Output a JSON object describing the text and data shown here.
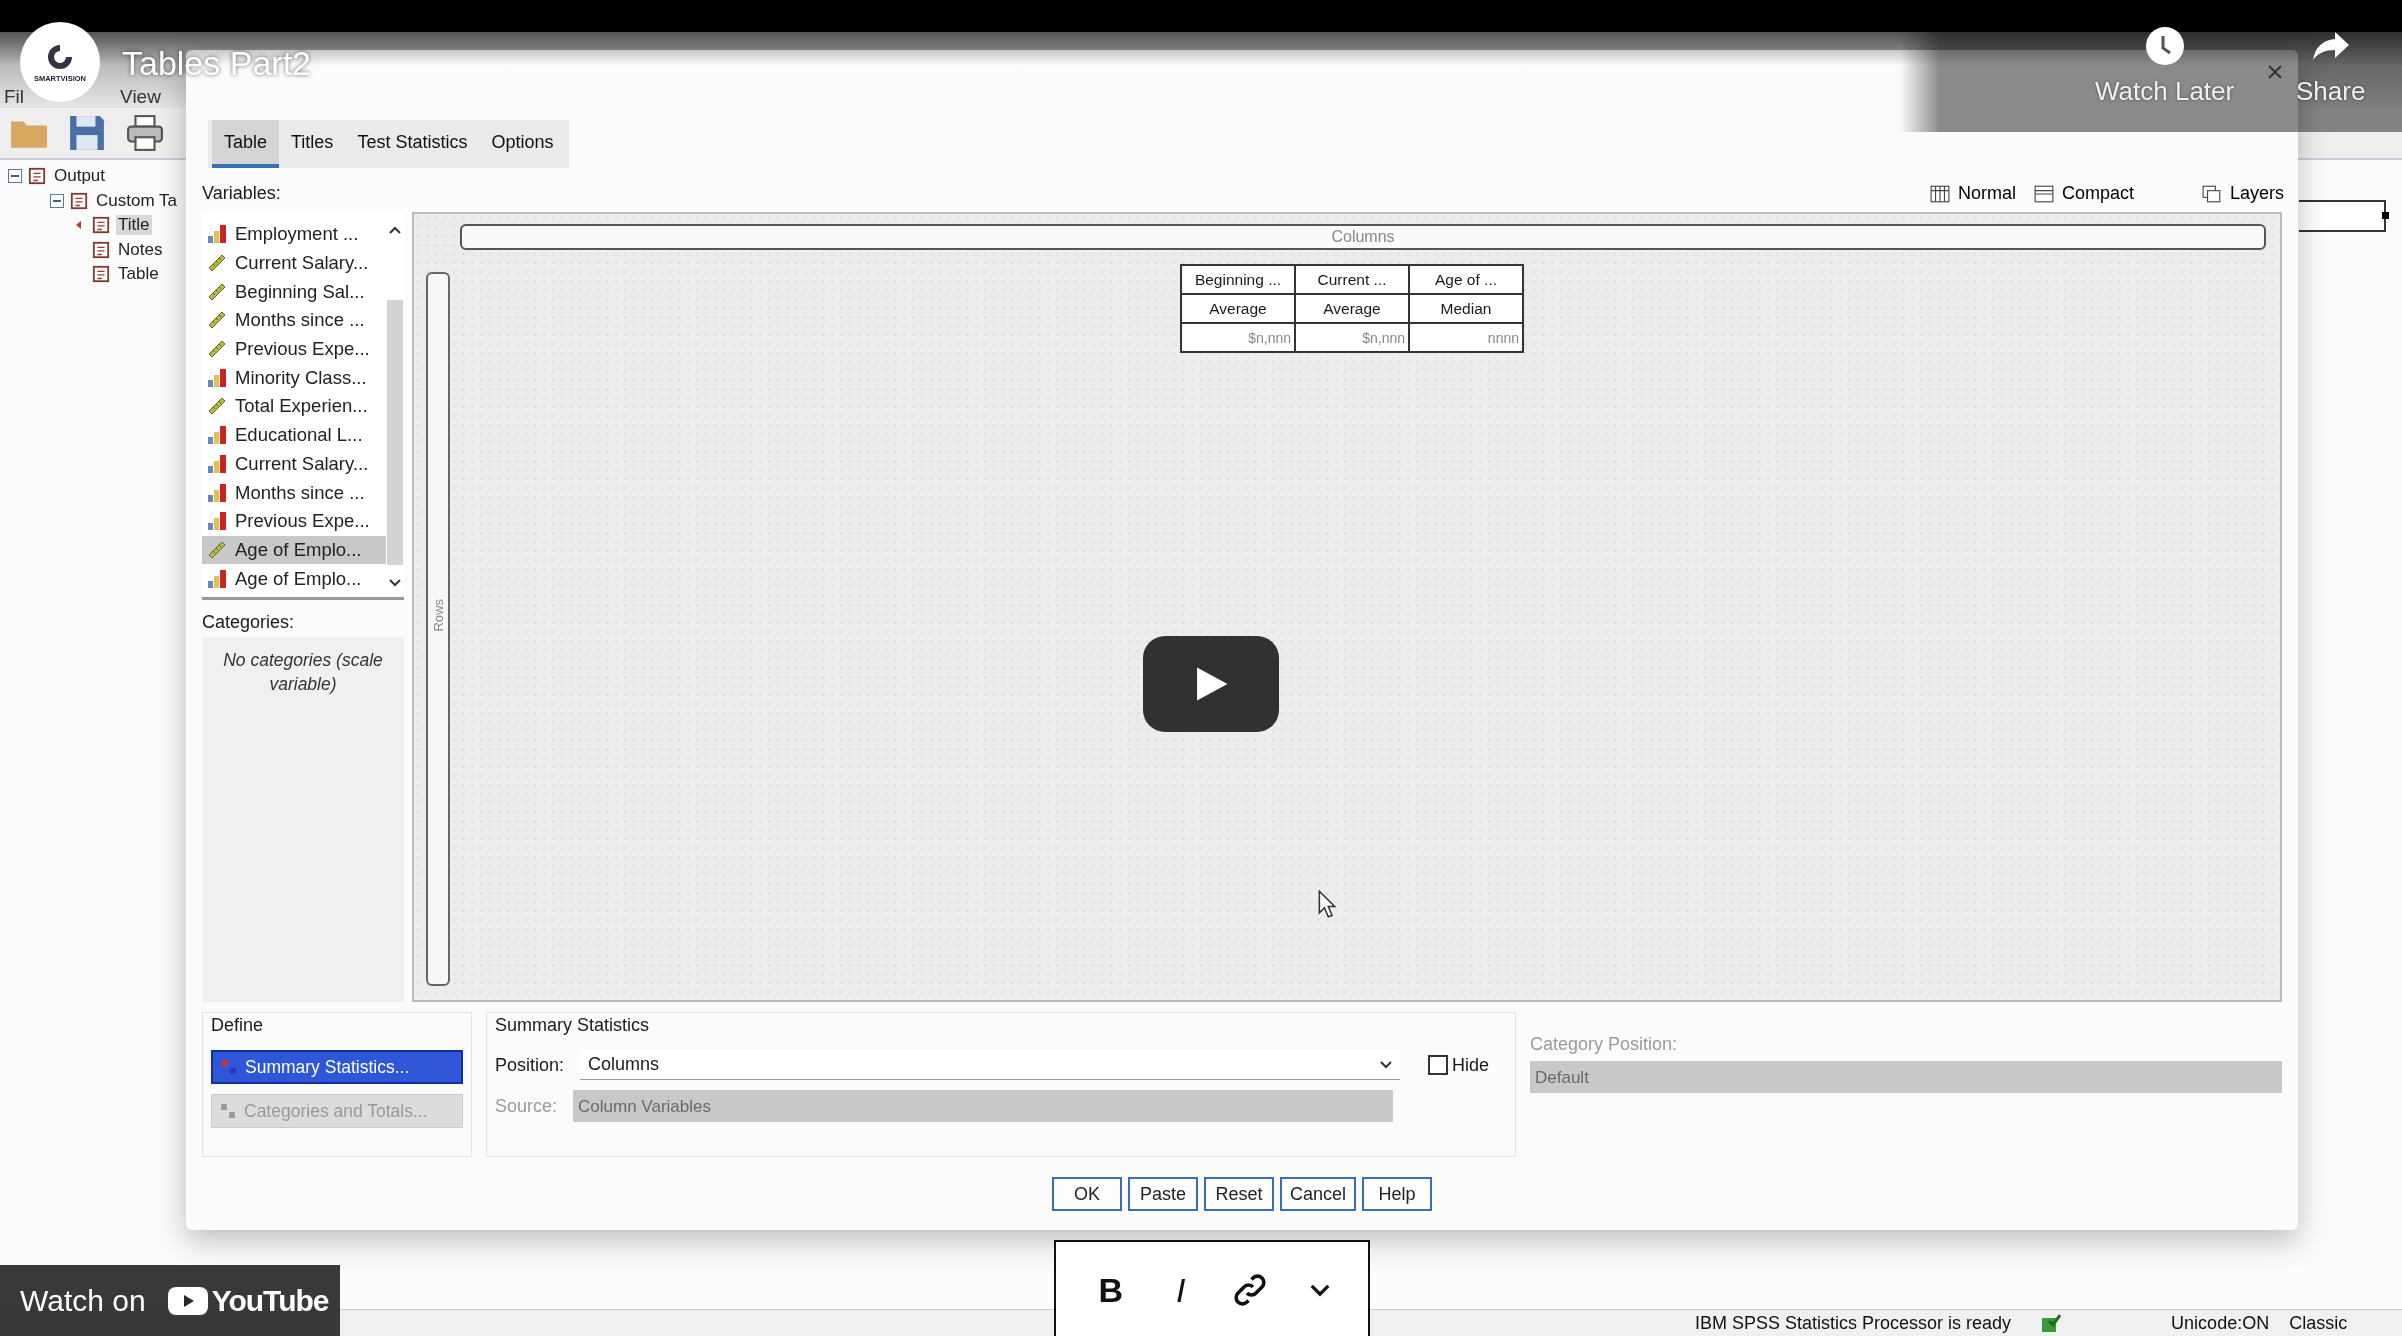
{
  "video": {
    "title": "Tables Part2",
    "channel_logo": "SMARTVISION",
    "watch_later": "Watch Later",
    "share": "Share",
    "watch_on": "Watch on",
    "youtube": "YouTube"
  },
  "viewer": {
    "menu": [
      "Fil",
      "View"
    ],
    "tree": [
      {
        "label": "Output",
        "expanded": true,
        "selected": false,
        "children": [
          {
            "label": "Custom Ta",
            "expanded": true,
            "selected": false,
            "children": [
              {
                "label": "Title",
                "selected": true
              },
              {
                "label": "Notes",
                "selected": false
              },
              {
                "label": "Table",
                "selected": false
              }
            ]
          }
        ]
      }
    ],
    "status_bar": {
      "message": "IBM SPSS Statistics Processor is ready",
      "encoding": "Unicode:ON",
      "mode": "Classic"
    }
  },
  "dialog": {
    "tabs": [
      {
        "label": "Table",
        "selected": true
      },
      {
        "label": "Titles",
        "selected": false
      },
      {
        "label": "Test Statistics",
        "selected": false
      },
      {
        "label": "Options",
        "selected": false
      }
    ],
    "variables_label": "Variables:",
    "view_options": [
      {
        "label": "Normal",
        "kind": "normal"
      },
      {
        "label": "Compact",
        "kind": "compact"
      },
      {
        "label": "Layers",
        "kind": "layers"
      }
    ],
    "variables": [
      {
        "name": "Employment ...",
        "kind": "nominal",
        "selected": false
      },
      {
        "name": "Current Salary...",
        "kind": "scale",
        "selected": false
      },
      {
        "name": "Beginning Sal...",
        "kind": "scale",
        "selected": false
      },
      {
        "name": "Months since ...",
        "kind": "scale",
        "selected": false
      },
      {
        "name": "Previous Expe...",
        "kind": "scale",
        "selected": false
      },
      {
        "name": "Minority Class...",
        "kind": "nominal",
        "selected": false
      },
      {
        "name": "Total Experien...",
        "kind": "scale",
        "selected": false
      },
      {
        "name": "Educational L...",
        "kind": "nominal",
        "selected": false
      },
      {
        "name": "Current Salary...",
        "kind": "nominal",
        "selected": false
      },
      {
        "name": "Months since ...",
        "kind": "nominal",
        "selected": false
      },
      {
        "name": "Previous Expe...",
        "kind": "nominal",
        "selected": false
      },
      {
        "name": "Age of  Emplo...",
        "kind": "scale",
        "selected": true
      },
      {
        "name": "Age of  Emplo...",
        "kind": "nominal",
        "selected": false
      }
    ],
    "categories_label": "Categories:",
    "categories_note": "No categories (scale variable)",
    "canvas": {
      "columns_label": "Columns",
      "rows_label": "Rows",
      "table": {
        "rows": [
          [
            "Beginning ...",
            "Current ...",
            "Age of ..."
          ],
          [
            "Average",
            "Average",
            "Median"
          ],
          [
            "$n,nnn",
            "$n,nnn",
            "nnnn"
          ]
        ]
      }
    },
    "define": {
      "title": "Define",
      "buttons": [
        {
          "label": "Summary Statistics...",
          "selected": true,
          "disabled": false
        },
        {
          "label": "Categories and Totals...",
          "selected": false,
          "disabled": true
        }
      ]
    },
    "summary_statistics": {
      "title": "Summary Statistics",
      "position_label": "Position:",
      "position_value": "Columns",
      "hide": {
        "label": "Hide",
        "checked": false
      },
      "source_label": "Source:",
      "source_value": "Column Variables",
      "source_disabled": true
    },
    "category_position": {
      "label": "Category Position:",
      "value": "Default",
      "disabled": true
    },
    "buttons": [
      "OK",
      "Paste",
      "Reset",
      "Cancel",
      "Help"
    ]
  },
  "format_toolbar": {
    "bold": "B",
    "italic": "I"
  }
}
